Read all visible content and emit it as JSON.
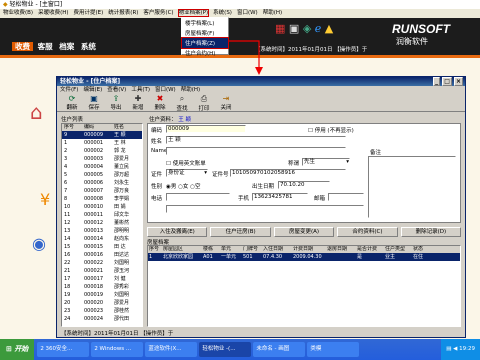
{
  "app": {
    "title": "轻松物业 - [主窗口]",
    "menu": [
      "物业收费(B)",
      "采暖收费(H)",
      "费用计提(E)",
      "统计报表(R)",
      "客户服务(C)",
      "物业档案(P)",
      "系统(S)",
      "窗口(W)",
      "帮助(H)"
    ],
    "nav_tabs": [
      "收费",
      "客服",
      "档案",
      "系统"
    ],
    "dropdown": [
      "楼宇档案(L)",
      "房屋档案(F)",
      "住户档案(Z)",
      "住户合约(H)"
    ],
    "brand_en": "RUNSOFT",
    "brand_cn": "润衡软件",
    "status_main": "【系统时间】2011年01月01日 【操作员】于",
    "status_bottom": "【系统时间】2011年01月01日 【操作员】于"
  },
  "child": {
    "title": "轻松物业 - [住户档案]",
    "menu": [
      "文件(F)",
      "编辑(E)",
      "查看(V)",
      "工具(T)",
      "窗口(W)",
      "帮助(H)"
    ],
    "toolbar": [
      "翻新",
      "保存",
      "导出",
      "新增",
      "删除",
      "查找",
      "打印",
      "关闭"
    ],
    "list_header": "住户列表",
    "current_label": "住户资料：",
    "current_name": "王 颖",
    "cols": [
      "序号",
      "编码",
      "姓名"
    ],
    "rows": [
      [
        "9",
        "000009",
        "王 颖"
      ],
      [
        "1",
        "000001",
        "王 林"
      ],
      [
        "2",
        "000002",
        "郭 龙"
      ],
      [
        "3",
        "000003",
        "邵爱月"
      ],
      [
        "4",
        "000004",
        "董立民"
      ],
      [
        "5",
        "000005",
        "邵万超"
      ],
      [
        "6",
        "000006",
        "刘永生"
      ],
      [
        "7",
        "000007",
        "邵万良"
      ],
      [
        "8",
        "000008",
        "李学娟"
      ],
      [
        "10",
        "000010",
        "田 娟"
      ],
      [
        "11",
        "000011",
        "邱文华"
      ],
      [
        "12",
        "000012",
        "董彬然"
      ],
      [
        "13",
        "000013",
        "邵明明"
      ],
      [
        "14",
        "000014",
        "赵向东"
      ],
      [
        "15",
        "000015",
        "田 达"
      ],
      [
        "16",
        "000016",
        "田达达"
      ],
      [
        "22",
        "000022",
        "刘国明"
      ],
      [
        "21",
        "000021",
        "邵玉河"
      ],
      [
        "17",
        "000017",
        "刘 健"
      ],
      [
        "18",
        "000018",
        "邵秀彩"
      ],
      [
        "19",
        "000019",
        "刘国明"
      ],
      [
        "20",
        "000020",
        "邵爱月"
      ],
      [
        "23",
        "000023",
        "邵桂然"
      ],
      [
        "24",
        "000024",
        "邵代田"
      ]
    ],
    "form": {
      "code_label": "编码",
      "code": "000009",
      "stop_label": "停用 (不再显示)",
      "name_label": "姓名",
      "name": "王 颖",
      "name_en_label": "Name",
      "use_en_label": "使用英文账单",
      "title_label": "称谓",
      "title": "先生",
      "remark_label": "备注",
      "id_type_label": "证件",
      "id_type": "身份证",
      "id_no_label": "证件号",
      "id_no": "101050970102058916",
      "sex_label": "性别",
      "sex_opts": [
        "男",
        "女",
        "空"
      ],
      "birth_label": "出生日期",
      "birth": "70.10.20",
      "phone_label": "电话",
      "mobile_label": "手机",
      "mobile": "13623425781",
      "email_label": "邮箱"
    },
    "actions": [
      "入住及搬离(E)",
      "住户迁房(B)",
      "房屋变更(A)",
      "合约资料(C)",
      "删除记录(D)"
    ],
    "house_header": "房屋档案",
    "house_cols": [
      "序号",
      "房屋园区",
      "楼栋",
      "单元",
      "门牌号",
      "入住日期",
      "计费日期",
      "退房日期",
      "是否计费",
      "住户类型",
      "状态"
    ],
    "house_rows": [
      [
        "1",
        "北京欣欣家园",
        "A01",
        "一单元",
        "501",
        "07.4.30",
        "2009.04.30",
        "",
        "是",
        "业主",
        "在住"
      ]
    ]
  },
  "taskbar": {
    "start": "开始",
    "items": [
      "2 360安全...",
      "2 Windows ...",
      "蓝途软件(X...",
      "轻松物业 -(...",
      "未命名 - 画图",
      "类模"
    ],
    "clock": "19:29"
  }
}
